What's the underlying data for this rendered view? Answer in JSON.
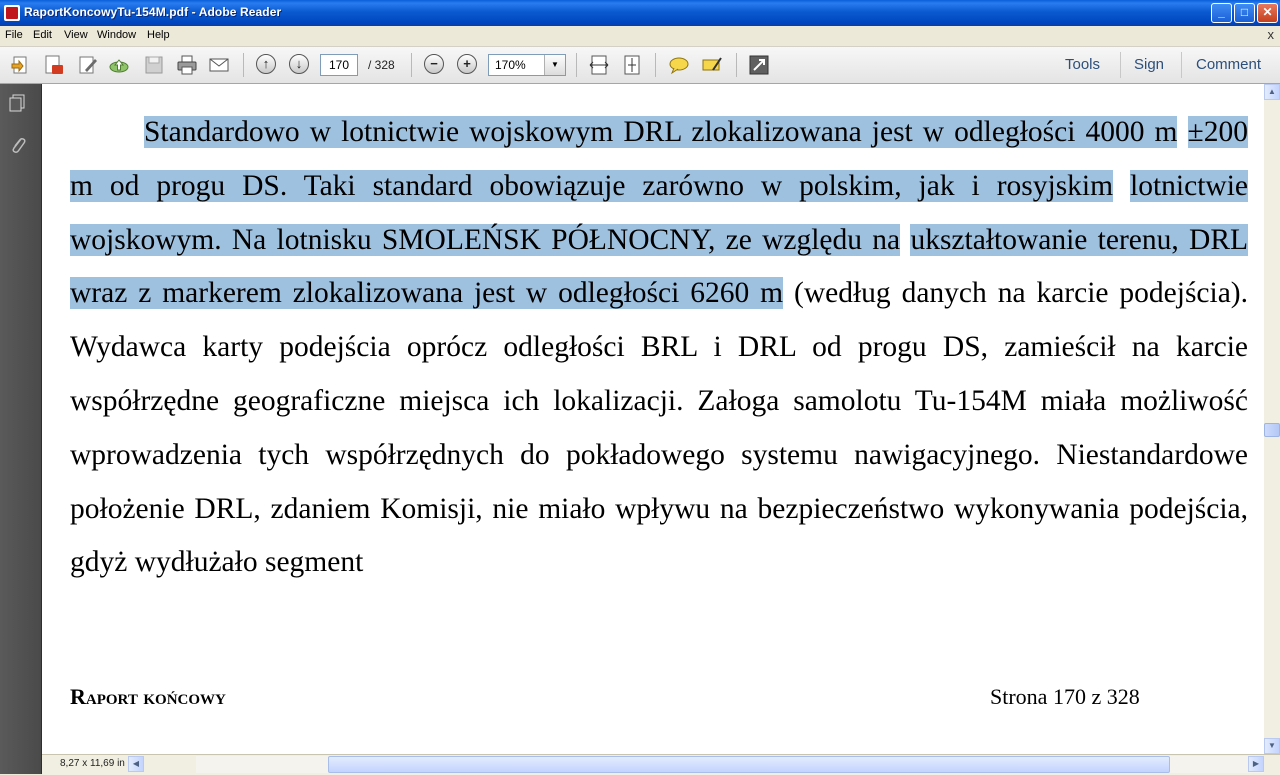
{
  "window": {
    "title": "RaportKoncowyTu-154M.pdf - Adobe Reader"
  },
  "menu": {
    "items": [
      "File",
      "Edit",
      "View",
      "Window",
      "Help"
    ],
    "close_glyph": "x"
  },
  "toolbar": {
    "current_page": "170",
    "page_total": "/  328",
    "zoom": "170%",
    "links": [
      "Tools",
      "Sign",
      "Comment"
    ]
  },
  "document": {
    "lines": [
      "Standardowo w lotnictwie wojskowym DRL zlokalizowana jest w odległości 4000 m",
      "±200 m od progu DS. Taki standard obowiązuje zarówno w polskim, jak i rosyjskim",
      "lotnictwie wojskowym. Na lotnisku SMOLEŃSK PÓŁNOCNY, ze względu na",
      "ukształtowanie terenu, DRL wraz z markerem zlokalizowana jest w odległości 6260 m",
      "(według danych na karcie podejścia). Wydawca karty podejścia oprócz odległości BRL",
      "i DRL od progu DS, zamieścił na karcie współrzędne geograficzne miejsca ich lokalizacji.",
      "Załoga samolotu Tu-154M miała możliwość wprowadzenia tych współrzędnych do",
      "pokładowego systemu nawigacyjnego. Niestandardowe położenie DRL, zdaniem Komisji, nie",
      "miało wpływu na bezpieczeństwo wykonywania podejścia, gdyż wydłużało segment"
    ],
    "footer_left": "Raport końcowy",
    "footer_right": "Strona 170 z 328",
    "highlight_color": "#9fc1e0"
  },
  "status": {
    "page_size": "8,27 x 11,69 in"
  }
}
